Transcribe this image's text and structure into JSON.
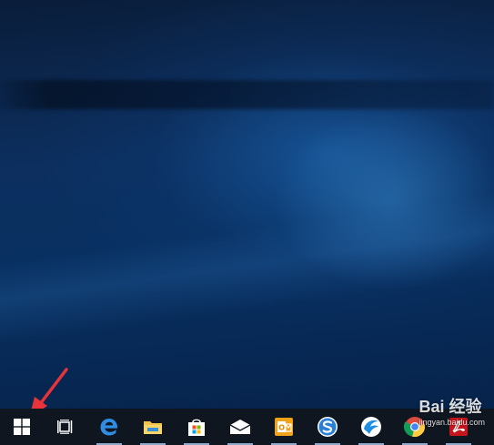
{
  "desktop": {
    "wallpaper": "windows-10-hero-wallpaper"
  },
  "taskbar": {
    "background": "#0f1620",
    "buttons": [
      {
        "name": "start-button",
        "icon": "windows-logo-icon",
        "pinned": false
      },
      {
        "name": "task-view-button",
        "icon": "task-view-icon",
        "pinned": false
      },
      {
        "name": "edge-button",
        "icon": "edge-icon",
        "pinned": true
      },
      {
        "name": "file-explorer-button",
        "icon": "folder-icon",
        "pinned": true
      },
      {
        "name": "store-button",
        "icon": "store-bag-icon",
        "pinned": true
      },
      {
        "name": "mail-button",
        "icon": "mail-icon",
        "pinned": true
      },
      {
        "name": "outlook-button",
        "icon": "outlook-icon",
        "pinned": true
      },
      {
        "name": "sogou-browser-button",
        "icon": "sogou-icon",
        "pinned": true
      },
      {
        "name": "qq-browser-button",
        "icon": "qq-icon",
        "pinned": true
      },
      {
        "name": "chrome-button",
        "icon": "chrome-icon",
        "pinned": true
      },
      {
        "name": "pdf-reader-button",
        "icon": "pdf-icon",
        "pinned": true
      }
    ]
  },
  "annotation": {
    "arrow_color": "#e8333a",
    "points_to": "start-button"
  },
  "watermark": {
    "brand": "Bai 经验",
    "url": "jingyan.baidu.com"
  }
}
